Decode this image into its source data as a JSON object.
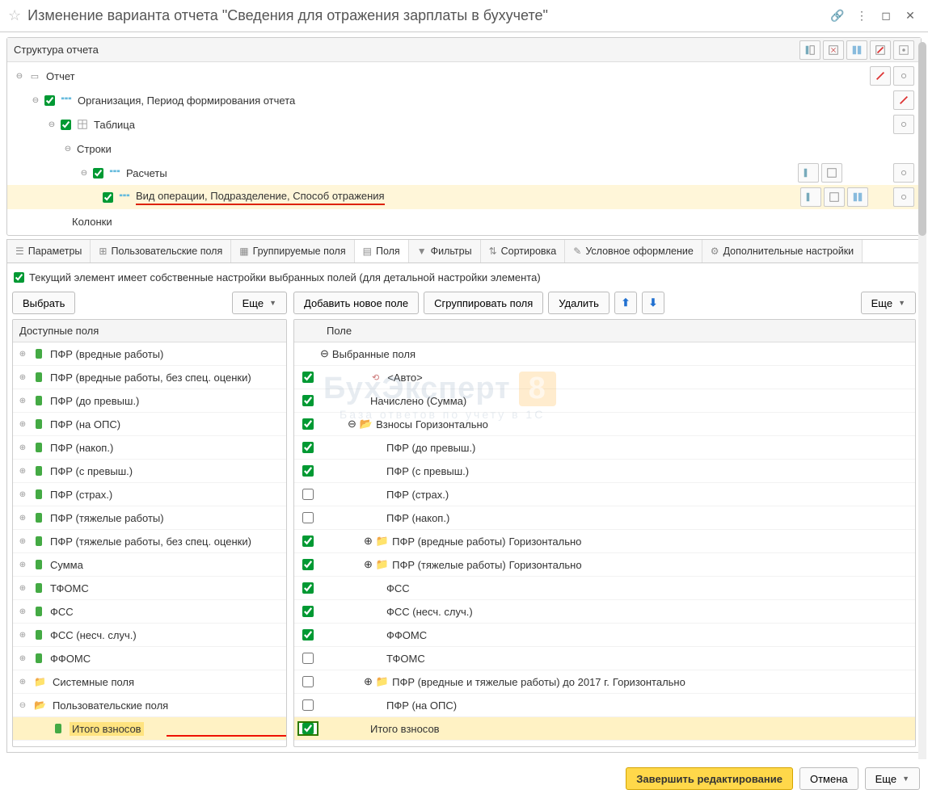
{
  "window": {
    "title": "Изменение варианта отчета \"Сведения для отражения зарплаты в бухучете\""
  },
  "structure_panel": {
    "header": "Структура отчета",
    "rows": [
      {
        "label": "Отчет"
      },
      {
        "label": "Организация, Период формирования отчета"
      },
      {
        "label": "Таблица"
      },
      {
        "label": "Строки"
      },
      {
        "label": "Расчеты"
      },
      {
        "label": "Вид операции, Подразделение, Способ отражения"
      },
      {
        "label": "Колонки"
      }
    ]
  },
  "tabs": [
    {
      "label": "Параметры"
    },
    {
      "label": "Пользовательские поля"
    },
    {
      "label": "Группируемые поля"
    },
    {
      "label": "Поля",
      "active": true
    },
    {
      "label": "Фильтры"
    },
    {
      "label": "Сортировка"
    },
    {
      "label": "Условное оформление"
    },
    {
      "label": "Дополнительные настройки"
    }
  ],
  "note": "Текущий элемент имеет собственные настройки выбранных полей (для детальной настройки элемента)",
  "left_toolbar": {
    "select": "Выбрать",
    "more": "Еще"
  },
  "right_toolbar": {
    "add": "Добавить новое поле",
    "group": "Сгруппировать поля",
    "del": "Удалить",
    "more": "Еще"
  },
  "left_header": "Доступные поля",
  "right_header": "Поле",
  "available_fields": [
    {
      "label": "ПФР (вредные работы)",
      "kind": "field"
    },
    {
      "label": "ПФР (вредные работы, без спец. оценки)",
      "kind": "field"
    },
    {
      "label": "ПФР (до превыш.)",
      "kind": "field"
    },
    {
      "label": "ПФР (на ОПС)",
      "kind": "field"
    },
    {
      "label": "ПФР (накоп.)",
      "kind": "field"
    },
    {
      "label": "ПФР (с превыш.)",
      "kind": "field"
    },
    {
      "label": "ПФР (страх.)",
      "kind": "field"
    },
    {
      "label": "ПФР (тяжелые работы)",
      "kind": "field"
    },
    {
      "label": "ПФР (тяжелые работы, без спец. оценки)",
      "kind": "field"
    },
    {
      "label": "Сумма",
      "kind": "field"
    },
    {
      "label": "ТФОМС",
      "kind": "field"
    },
    {
      "label": "ФСС",
      "kind": "field"
    },
    {
      "label": "ФСС (несч. случ.)",
      "kind": "field"
    },
    {
      "label": "ФФОМС",
      "kind": "field"
    },
    {
      "label": "Системные поля",
      "kind": "folder"
    },
    {
      "label": "Пользовательские поля",
      "kind": "folder-open",
      "children": [
        {
          "label": "Итого взносов",
          "kind": "field",
          "hl": true
        }
      ]
    }
  ],
  "selected_root": "Выбранные поля",
  "selected_fields": [
    {
      "checked": true,
      "indent": 1,
      "kind": "auto",
      "label": "<Авто>"
    },
    {
      "checked": true,
      "indent": 1,
      "kind": "field",
      "label": "Начислено (Сумма)"
    },
    {
      "checked": true,
      "indent": 0,
      "kind": "folder-open",
      "exp": "minus",
      "label": "Взносы",
      "suffix": "Горизонтально"
    },
    {
      "checked": true,
      "indent": 2,
      "kind": "field",
      "label": "ПФР (до превыш.)"
    },
    {
      "checked": true,
      "indent": 2,
      "kind": "field",
      "label": "ПФР (с превыш.)"
    },
    {
      "checked": false,
      "indent": 2,
      "kind": "field",
      "label": "ПФР (страх.)"
    },
    {
      "checked": false,
      "indent": 2,
      "kind": "field",
      "label": "ПФР (накоп.)"
    },
    {
      "checked": true,
      "indent": 1,
      "kind": "folder",
      "exp": "plus",
      "label": "ПФР (вредные работы)",
      "suffix": "Горизонтально"
    },
    {
      "checked": true,
      "indent": 1,
      "kind": "folder",
      "exp": "plus",
      "label": "ПФР (тяжелые работы)",
      "suffix": "Горизонтально"
    },
    {
      "checked": true,
      "indent": 2,
      "kind": "field",
      "label": "ФСС"
    },
    {
      "checked": true,
      "indent": 2,
      "kind": "field",
      "label": "ФСС (несч. случ.)"
    },
    {
      "checked": true,
      "indent": 2,
      "kind": "field",
      "label": "ФФОМС"
    },
    {
      "checked": false,
      "indent": 2,
      "kind": "field",
      "label": "ТФОМС"
    },
    {
      "checked": false,
      "indent": 1,
      "kind": "folder",
      "exp": "plus",
      "label": "ПФР (вредные и тяжелые работы) до 2017 г.",
      "suffix": "Горизонтально"
    },
    {
      "checked": false,
      "indent": 2,
      "kind": "field",
      "label": "ПФР (на ОПС)"
    },
    {
      "checked": true,
      "indent": 1,
      "kind": "field",
      "label": "Итого взносов",
      "hl": true
    }
  ],
  "footer": {
    "finish": "Завершить редактирование",
    "cancel": "Отмена",
    "more": "Еще"
  },
  "watermark": {
    "main": "БухЭксперт",
    "eight": "8",
    "sub": "База ответов по учету в 1С"
  }
}
